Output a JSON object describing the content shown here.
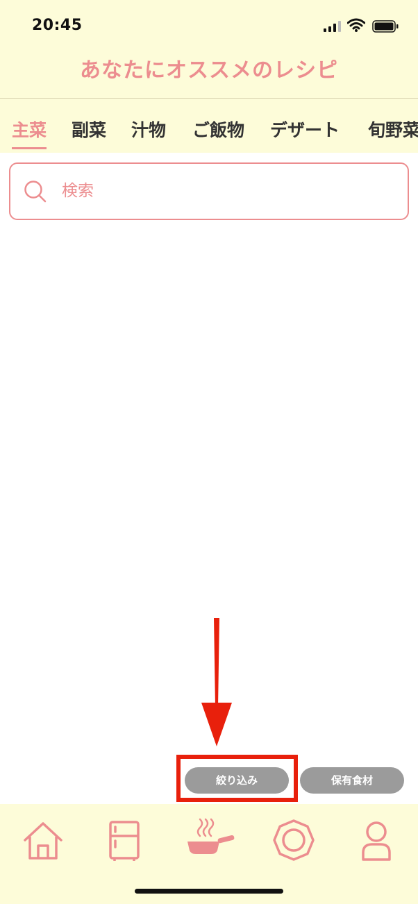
{
  "status_bar": {
    "time": "20:45",
    "icons": [
      "signal-icon",
      "wifi-icon",
      "battery-icon"
    ]
  },
  "header": {
    "title": "あなたにオススメのレシピ"
  },
  "tabs": [
    {
      "label": "主菜",
      "active": true
    },
    {
      "label": "副菜",
      "active": false
    },
    {
      "label": "汁物",
      "active": false
    },
    {
      "label": "ご飯物",
      "active": false
    },
    {
      "label": "デザート",
      "active": false
    },
    {
      "label": "旬野菜",
      "active": false
    }
  ],
  "search": {
    "placeholder": "検索",
    "value": ""
  },
  "actions": {
    "filter_label": "絞り込み",
    "owned_ingredients_label": "保有食材"
  },
  "tab_bar": {
    "items": [
      "home-icon",
      "fridge-icon",
      "cooking-pan-icon",
      "plate-icon",
      "profile-icon"
    ],
    "active_index": 2
  },
  "colors": {
    "accent": "#ec8d8f",
    "header_bg": "#fdfcd9",
    "annotation_red": "#e8200c",
    "pill_gray": "#9b9b9b"
  }
}
